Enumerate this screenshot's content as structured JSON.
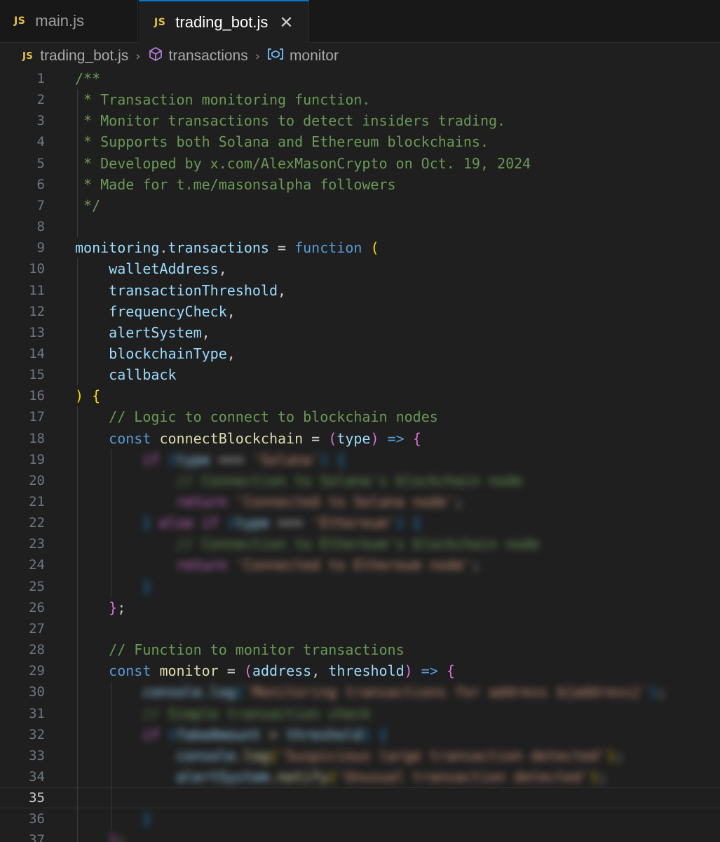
{
  "tabs": [
    {
      "badge": "JS",
      "label": "main.js",
      "active": false
    },
    {
      "badge": "JS",
      "label": "trading_bot.js",
      "active": true,
      "close": "✕"
    }
  ],
  "breadcrumb": {
    "file_badge": "JS",
    "file": "trading_bot.js",
    "symbol": "transactions",
    "variable": "monitor",
    "separator": "›"
  },
  "editor": {
    "current_line": 35,
    "lines": [
      {
        "n": "1",
        "tokens": [
          {
            "t": "/**",
            "c": "com"
          }
        ]
      },
      {
        "n": "2",
        "tokens": [
          {
            "t": " * Transaction monitoring function.",
            "c": "com"
          }
        ]
      },
      {
        "n": "3",
        "tokens": [
          {
            "t": " * Monitor transactions to detect insiders trading.",
            "c": "com"
          }
        ]
      },
      {
        "n": "4",
        "tokens": [
          {
            "t": " * Supports both Solana and Ethereum blockchains.",
            "c": "com"
          }
        ]
      },
      {
        "n": "5",
        "tokens": [
          {
            "t": " * Developed by x.com/AlexMasonCrypto on Oct. 19, 2024",
            "c": "com"
          }
        ]
      },
      {
        "n": "6",
        "tokens": [
          {
            "t": " * Made for t.me/masonsalpha followers",
            "c": "com"
          }
        ]
      },
      {
        "n": "7",
        "tokens": [
          {
            "t": " */",
            "c": "com"
          }
        ]
      },
      {
        "n": "8",
        "tokens": []
      },
      {
        "n": "9",
        "tokens": [
          {
            "t": "monitoring",
            "c": "var"
          },
          {
            "t": ".",
            "c": "pun"
          },
          {
            "t": "transactions",
            "c": "var"
          },
          {
            "t": " = ",
            "c": "pun"
          },
          {
            "t": "function",
            "c": "kw"
          },
          {
            "t": " ",
            "c": "pun"
          },
          {
            "t": "(",
            "c": "br1"
          }
        ]
      },
      {
        "n": "10",
        "tokens": [
          {
            "t": "    ",
            "c": "pun"
          },
          {
            "t": "walletAddress",
            "c": "var"
          },
          {
            "t": ",",
            "c": "pun"
          }
        ]
      },
      {
        "n": "11",
        "tokens": [
          {
            "t": "    ",
            "c": "pun"
          },
          {
            "t": "transactionThreshold",
            "c": "var"
          },
          {
            "t": ",",
            "c": "pun"
          }
        ]
      },
      {
        "n": "12",
        "tokens": [
          {
            "t": "    ",
            "c": "pun"
          },
          {
            "t": "frequencyCheck",
            "c": "var"
          },
          {
            "t": ",",
            "c": "pun"
          }
        ]
      },
      {
        "n": "13",
        "tokens": [
          {
            "t": "    ",
            "c": "pun"
          },
          {
            "t": "alertSystem",
            "c": "var"
          },
          {
            "t": ",",
            "c": "pun"
          }
        ]
      },
      {
        "n": "14",
        "tokens": [
          {
            "t": "    ",
            "c": "pun"
          },
          {
            "t": "blockchainType",
            "c": "var"
          },
          {
            "t": ",",
            "c": "pun"
          }
        ]
      },
      {
        "n": "15",
        "tokens": [
          {
            "t": "    ",
            "c": "pun"
          },
          {
            "t": "callback",
            "c": "var"
          }
        ]
      },
      {
        "n": "16",
        "tokens": [
          {
            "t": ")",
            "c": "br1"
          },
          {
            "t": " ",
            "c": "pun"
          },
          {
            "t": "{",
            "c": "br1"
          }
        ]
      },
      {
        "n": "17",
        "tokens": [
          {
            "t": "    ",
            "c": "pun"
          },
          {
            "t": "// Logic to connect to blockchain nodes",
            "c": "com"
          }
        ]
      },
      {
        "n": "18",
        "tokens": [
          {
            "t": "    ",
            "c": "pun"
          },
          {
            "t": "const",
            "c": "kw"
          },
          {
            "t": " ",
            "c": "pun"
          },
          {
            "t": "connectBlockchain",
            "c": "fn"
          },
          {
            "t": " = ",
            "c": "pun"
          },
          {
            "t": "(",
            "c": "br2"
          },
          {
            "t": "type",
            "c": "var"
          },
          {
            "t": ")",
            "c": "br2"
          },
          {
            "t": " ",
            "c": "pun"
          },
          {
            "t": "=>",
            "c": "kw"
          },
          {
            "t": " ",
            "c": "pun"
          },
          {
            "t": "{",
            "c": "br2"
          }
        ]
      },
      {
        "n": "19",
        "blur": true,
        "tokens": [
          {
            "t": "        ",
            "c": "pun"
          },
          {
            "t": "if",
            "c": "br2"
          },
          {
            "t": " ",
            "c": "pun"
          },
          {
            "t": "(",
            "c": "br3"
          },
          {
            "t": "type",
            "c": "var"
          },
          {
            "t": " === ",
            "c": "pun"
          },
          {
            "t": "'Solana'",
            "c": "str"
          },
          {
            "t": ")",
            "c": "br3"
          },
          {
            "t": " ",
            "c": "pun"
          },
          {
            "t": "{",
            "c": "br3"
          }
        ]
      },
      {
        "n": "20",
        "blur": true,
        "tokens": [
          {
            "t": "            ",
            "c": "pun"
          },
          {
            "t": "// Connection to Solana's blockchain node",
            "c": "com"
          }
        ]
      },
      {
        "n": "21",
        "blur": true,
        "tokens": [
          {
            "t": "            ",
            "c": "pun"
          },
          {
            "t": "return",
            "c": "br2"
          },
          {
            "t": " ",
            "c": "pun"
          },
          {
            "t": "'Connected to Solana node'",
            "c": "str"
          },
          {
            "t": ";",
            "c": "pun"
          }
        ]
      },
      {
        "n": "22",
        "blur": true,
        "tokens": [
          {
            "t": "        ",
            "c": "pun"
          },
          {
            "t": "}",
            "c": "br3"
          },
          {
            "t": " else if ",
            "c": "br2"
          },
          {
            "t": "(",
            "c": "br3"
          },
          {
            "t": "type",
            "c": "var"
          },
          {
            "t": " === ",
            "c": "pun"
          },
          {
            "t": "'Ethereum'",
            "c": "str"
          },
          {
            "t": ")",
            "c": "br3"
          },
          {
            "t": " {",
            "c": "br3"
          }
        ]
      },
      {
        "n": "23",
        "blur": true,
        "tokens": [
          {
            "t": "            ",
            "c": "pun"
          },
          {
            "t": "// Connection to Ethereum's blockchain node",
            "c": "com"
          }
        ]
      },
      {
        "n": "24",
        "blur": true,
        "tokens": [
          {
            "t": "            ",
            "c": "pun"
          },
          {
            "t": "return",
            "c": "br2"
          },
          {
            "t": " ",
            "c": "pun"
          },
          {
            "t": "'Connected to Ethereum node'",
            "c": "str"
          },
          {
            "t": ";",
            "c": "pun"
          }
        ]
      },
      {
        "n": "25",
        "blur": true,
        "tokens": [
          {
            "t": "        ",
            "c": "pun"
          },
          {
            "t": "}",
            "c": "br3"
          }
        ]
      },
      {
        "n": "26",
        "tokens": [
          {
            "t": "    ",
            "c": "pun"
          },
          {
            "t": "}",
            "c": "br2"
          },
          {
            "t": ";",
            "c": "pun"
          }
        ]
      },
      {
        "n": "27",
        "tokens": []
      },
      {
        "n": "28",
        "tokens": [
          {
            "t": "    ",
            "c": "pun"
          },
          {
            "t": "// Function to monitor transactions",
            "c": "com"
          }
        ]
      },
      {
        "n": "29",
        "tokens": [
          {
            "t": "    ",
            "c": "pun"
          },
          {
            "t": "const",
            "c": "kw"
          },
          {
            "t": " ",
            "c": "pun"
          },
          {
            "t": "monitor",
            "c": "fn"
          },
          {
            "t": " = ",
            "c": "pun"
          },
          {
            "t": "(",
            "c": "br2"
          },
          {
            "t": "address",
            "c": "var"
          },
          {
            "t": ", ",
            "c": "pun"
          },
          {
            "t": "threshold",
            "c": "var"
          },
          {
            "t": ")",
            "c": "br2"
          },
          {
            "t": " ",
            "c": "pun"
          },
          {
            "t": "=>",
            "c": "kw"
          },
          {
            "t": " ",
            "c": "pun"
          },
          {
            "t": "{",
            "c": "br2"
          }
        ]
      },
      {
        "n": "30",
        "blur": true,
        "tokens": [
          {
            "t": "        ",
            "c": "pun"
          },
          {
            "t": "console.log",
            "c": "var"
          },
          {
            "t": "(",
            "c": "br3"
          },
          {
            "t": "`Monitoring transactions for address ${address}`",
            "c": "str"
          },
          {
            "t": ")",
            "c": "br3"
          },
          {
            "t": ";",
            "c": "pun"
          }
        ]
      },
      {
        "n": "31",
        "blur": true,
        "tokens": [
          {
            "t": "        ",
            "c": "pun"
          },
          {
            "t": "// Simple transaction check",
            "c": "com"
          }
        ]
      },
      {
        "n": "32",
        "blur": true,
        "tokens": [
          {
            "t": "        ",
            "c": "pun"
          },
          {
            "t": "if",
            "c": "br2"
          },
          {
            "t": " ",
            "c": "pun"
          },
          {
            "t": "(",
            "c": "br3"
          },
          {
            "t": "fakeAmount",
            "c": "var"
          },
          {
            "t": " > ",
            "c": "pun"
          },
          {
            "t": "threshold",
            "c": "var"
          },
          {
            "t": ")",
            "c": "br3"
          },
          {
            "t": " {",
            "c": "br3"
          }
        ]
      },
      {
        "n": "33",
        "blur": true,
        "tokens": [
          {
            "t": "            ",
            "c": "pun"
          },
          {
            "t": "console",
            "c": "var"
          },
          {
            "t": ".log",
            "c": "fn"
          },
          {
            "t": "(",
            "c": "br1"
          },
          {
            "t": "'Suspicious large transaction detected'",
            "c": "str"
          },
          {
            "t": ")",
            "c": "br1"
          },
          {
            "t": ";",
            "c": "pun"
          }
        ]
      },
      {
        "n": "34",
        "blur": true,
        "tokens": [
          {
            "t": "            ",
            "c": "pun"
          },
          {
            "t": "alertSystem",
            "c": "var"
          },
          {
            "t": ".notify",
            "c": "fn"
          },
          {
            "t": "(",
            "c": "br1"
          },
          {
            "t": "'Unusual transaction detected'",
            "c": "str"
          },
          {
            "t": ")",
            "c": "br1"
          },
          {
            "t": ";",
            "c": "pun"
          }
        ]
      },
      {
        "n": "35",
        "tokens": []
      },
      {
        "n": "36",
        "blur": true,
        "tokens": [
          {
            "t": "        ",
            "c": "pun"
          },
          {
            "t": "}",
            "c": "br3"
          }
        ]
      },
      {
        "n": "37",
        "blur": true,
        "tokens": [
          {
            "t": "    ",
            "c": "pun"
          },
          {
            "t": "}",
            "c": "br2"
          },
          {
            "t": ";",
            "c": "pun"
          }
        ]
      }
    ]
  },
  "colors": {
    "background": "#1f1f1f",
    "tab_active_border": "#0078d4",
    "js_badge": "#e8c547",
    "comment": "#6a9955",
    "keyword": "#569cd6",
    "variable": "#9cdcfe",
    "function": "#dcdcaa",
    "bracket_gold": "#ffd700",
    "bracket_purple": "#da70d6",
    "bracket_blue": "#179fff"
  },
  "icons": {
    "symbol": "cube-icon",
    "variable": "variable-icon",
    "close": "close-icon"
  }
}
